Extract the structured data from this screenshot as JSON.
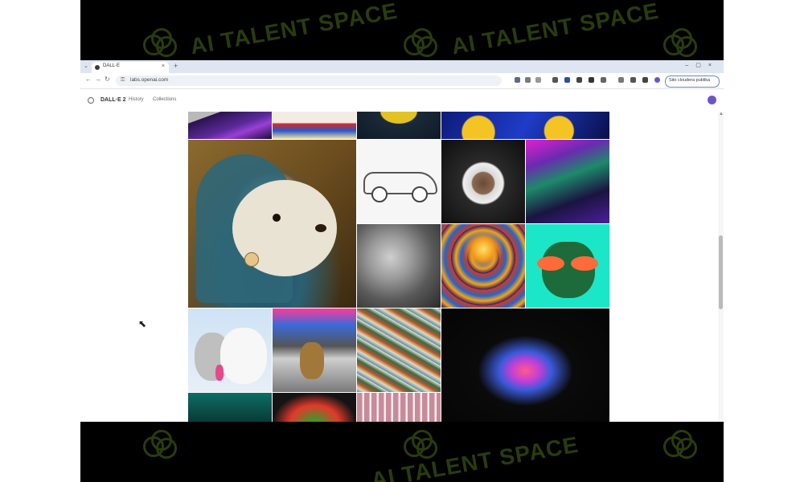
{
  "watermark": {
    "text": "AI TALENT SPACE",
    "logo_icon": "clover-logo-icon",
    "color": "#2a3b0c"
  },
  "browser": {
    "tab_title": "DALL·E",
    "new_tab_label": "+",
    "url": "labs.openai.com",
    "profile_label": "Sito cloudera publika"
  },
  "app": {
    "name": "DALL·E 2",
    "nav": [
      {
        "label": "History"
      },
      {
        "label": "Collections"
      }
    ],
    "avatar_color": "#6b54c9"
  },
  "gallery": {
    "tiles": [
      {
        "subject": "planet-purple-lines",
        "color": "#3a1e6a"
      },
      {
        "subject": "red-blue-object",
        "color": "#e6e2dc"
      },
      {
        "subject": "yellow-sun",
        "color": "#1b2a3a"
      },
      {
        "subject": "astronaut-helmets",
        "color": "#1a2b88"
      },
      {
        "subject": "otter-renaissance-portrait",
        "color": "#4a6f7a"
      },
      {
        "subject": "porsche-sketch",
        "color": "#f4f4f4"
      },
      {
        "subject": "monkey-astronaut",
        "color": "#1a1a1a"
      },
      {
        "subject": "neon-city-street",
        "color": "#2b1f5a"
      },
      {
        "subject": "david-statue",
        "color": "#7a7a7a"
      },
      {
        "subject": "psychedelic-lightbulb",
        "color": "#d2541a"
      },
      {
        "subject": "bulldog-sunglasses",
        "color": "#1ce6c8"
      },
      {
        "subject": "cat-and-dog",
        "color": "#dfe4ee"
      },
      {
        "subject": "teddy-bear-times-square",
        "color": "#8a8a8a"
      },
      {
        "subject": "mosaic-river-valley",
        "color": "#4f86a6"
      },
      {
        "subject": "color-powder-explosion",
        "color": "#050505"
      },
      {
        "subject": "teal-cube",
        "color": "#0c6e66"
      },
      {
        "subject": "green-red-cat",
        "color": "#2a8c2a"
      },
      {
        "subject": "pink-building",
        "color": "#c98a9a"
      }
    ]
  }
}
